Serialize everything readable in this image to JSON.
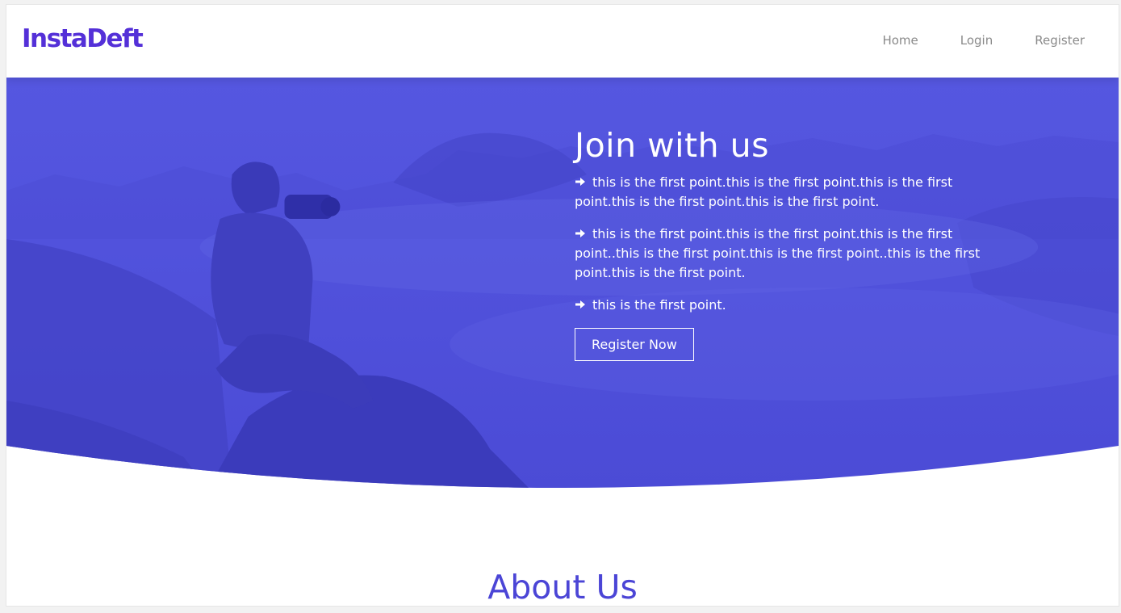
{
  "brand": {
    "logo": "InstaDeft",
    "logo_color": "#5430d8"
  },
  "nav": {
    "items": [
      "Home",
      "Login",
      "Register"
    ]
  },
  "hero": {
    "title": "Join with us",
    "points": [
      "this is the first point.this is the first point.this is the first point.this is the first point.this is the first point.",
      "this is the first point.this is the first point.this is the first point..this is the first point.this is the first point..this is the first point.this is the first point.",
      "this is the first point."
    ],
    "point_icon": "arrow-right-icon",
    "button": "Register Now",
    "overlay_color": "#4f4fdc"
  },
  "about": {
    "title": "About Us",
    "color": "#4b45d6"
  }
}
